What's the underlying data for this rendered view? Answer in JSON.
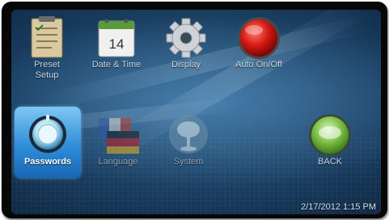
{
  "menu": {
    "tiles": [
      {
        "label": "Preset\nSetup",
        "icon": "clipboard-icon"
      },
      {
        "label": "Date & Time",
        "icon": "calendar-icon",
        "calendar_day": "14"
      },
      {
        "label": "Display",
        "icon": "gear-icon"
      },
      {
        "label": "Auto On/Off",
        "icon": "power-icon"
      },
      {
        "label": "Passwords",
        "icon": "lock-dial-icon",
        "selected": true
      },
      {
        "label": "Language",
        "icon": "flags-icon"
      },
      {
        "label": "System",
        "icon": "tree-icon"
      },
      {
        "label": "BACK",
        "icon": "back-icon"
      }
    ]
  },
  "status_bar": {
    "datetime": "2/17/2012 1:15 PM"
  },
  "colors": {
    "selection": "#2f8ed8",
    "auto_off_red": "#c81414",
    "back_green": "#6fb334",
    "screen_blue": "#173a5c"
  }
}
